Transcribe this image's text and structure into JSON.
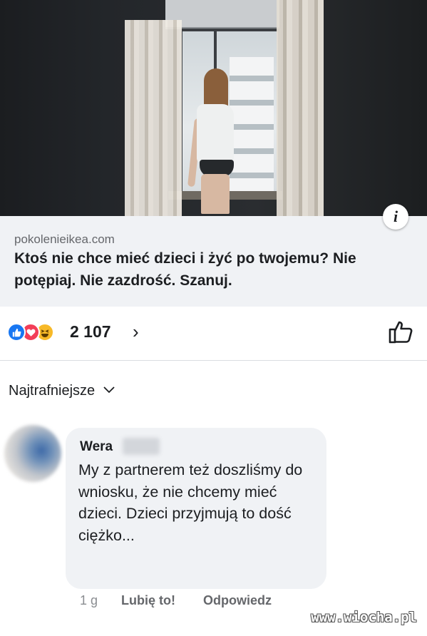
{
  "link_preview": {
    "domain": "pokolenieikea.com",
    "headline": "Ktoś nie chce mieć dzieci i żyć po twojemu? Nie potępiaj. Nie zazdrość. Szanuj.",
    "info_icon": "info-icon"
  },
  "reactions": {
    "icons": [
      "like-reaction-icon",
      "love-reaction-icon",
      "haha-reaction-icon"
    ],
    "count": "2 107",
    "chevron": "›",
    "like_button_icon": "thumbs-up-icon",
    "colors": {
      "like": "#1877f2",
      "love": "#f33e58",
      "haha": "#f7b928"
    }
  },
  "comments": {
    "sort_label": "Najtrafniejsze",
    "items": [
      {
        "author": "Wera",
        "text": "My z partnerem też doszliśmy do wniosku, że nie chcemy mieć dzieci. Dzieci przyjmują to dość ciężko...",
        "time": "1 g",
        "like_label": "Lubię to!",
        "reply_label": "Odpowiedz"
      }
    ]
  },
  "watermark": "www.wiocha.pl"
}
